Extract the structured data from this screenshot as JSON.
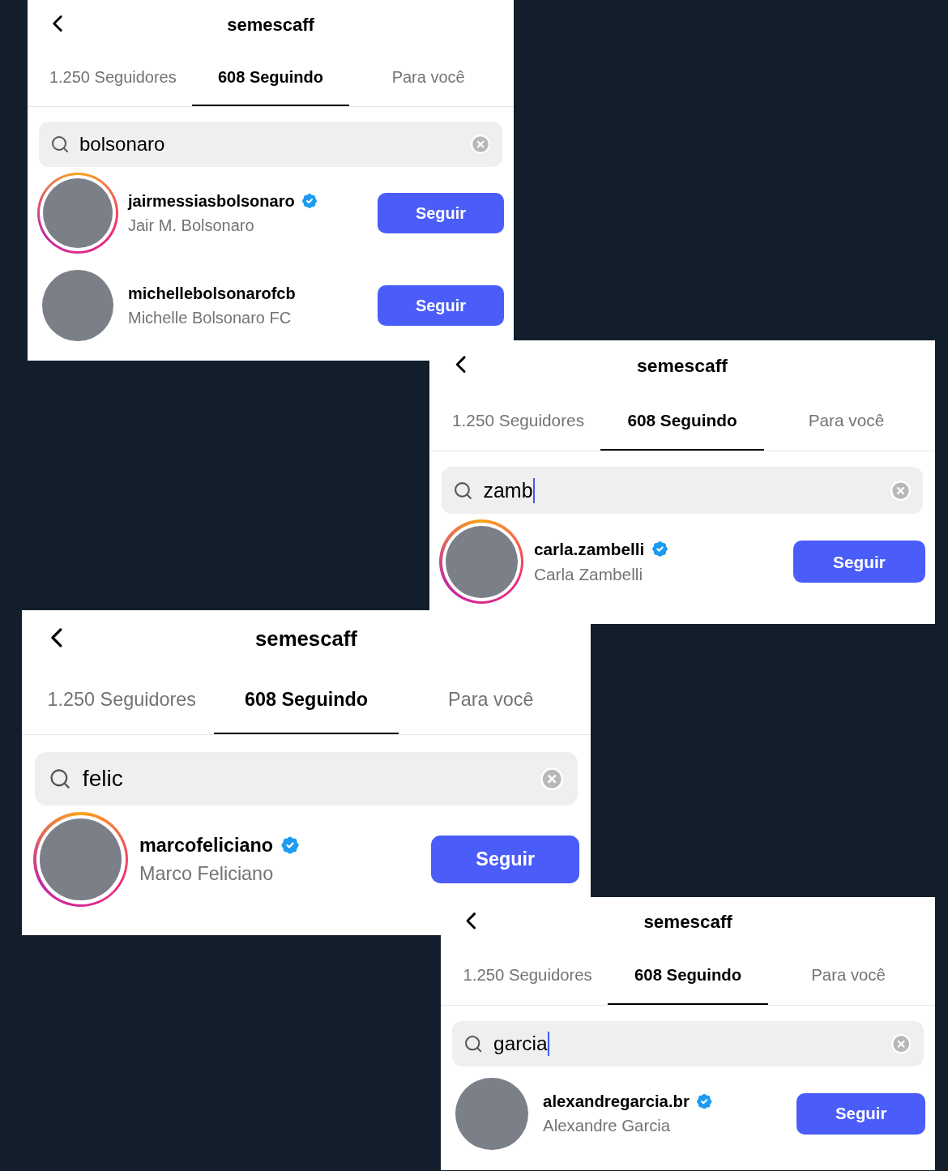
{
  "panels": [
    {
      "title": "semescaff",
      "tabs": [
        {
          "label": "1.250 Seguidores",
          "selected": false
        },
        {
          "label": "608 Seguindo",
          "selected": true
        },
        {
          "label": "Para você",
          "selected": false
        }
      ],
      "search": {
        "value": "bolsonaro",
        "focused": false
      },
      "results": [
        {
          "username": "jairmessiasbolsonaro",
          "verified": true,
          "name": "Jair M. Bolsonaro",
          "story_ring": true,
          "button": "Seguir"
        },
        {
          "username": "michellebolsonarofcb",
          "verified": false,
          "name": "Michelle Bolsonaro FC",
          "story_ring": false,
          "button": "Seguir"
        }
      ]
    },
    {
      "title": "semescaff",
      "tabs": [
        {
          "label": "1.250 Seguidores",
          "selected": false
        },
        {
          "label": "608 Seguindo",
          "selected": true
        },
        {
          "label": "Para você",
          "selected": false
        }
      ],
      "search": {
        "value": "zamb",
        "focused": true
      },
      "results": [
        {
          "username": "carla.zambelli",
          "verified": true,
          "name": "Carla Zambelli",
          "story_ring": true,
          "button": "Seguir"
        }
      ]
    },
    {
      "title": "semescaff",
      "tabs": [
        {
          "label": "1.250 Seguidores",
          "selected": false
        },
        {
          "label": "608 Seguindo",
          "selected": true
        },
        {
          "label": "Para você",
          "selected": false
        }
      ],
      "search": {
        "value": "felic",
        "focused": false
      },
      "results": [
        {
          "username": "marcofeliciano",
          "verified": true,
          "name": "Marco Feliciano",
          "story_ring": true,
          "button": "Seguir"
        }
      ]
    },
    {
      "title": "semescaff",
      "tabs": [
        {
          "label": "1.250 Seguidores",
          "selected": false
        },
        {
          "label": "608 Seguindo",
          "selected": true
        },
        {
          "label": "Para você",
          "selected": false
        }
      ],
      "search": {
        "value": "garcia",
        "focused": true
      },
      "results": [
        {
          "username": "alexandregarcia.br",
          "verified": true,
          "name": "Alexandre Garcia",
          "story_ring": false,
          "button": "Seguir"
        }
      ]
    }
  ]
}
